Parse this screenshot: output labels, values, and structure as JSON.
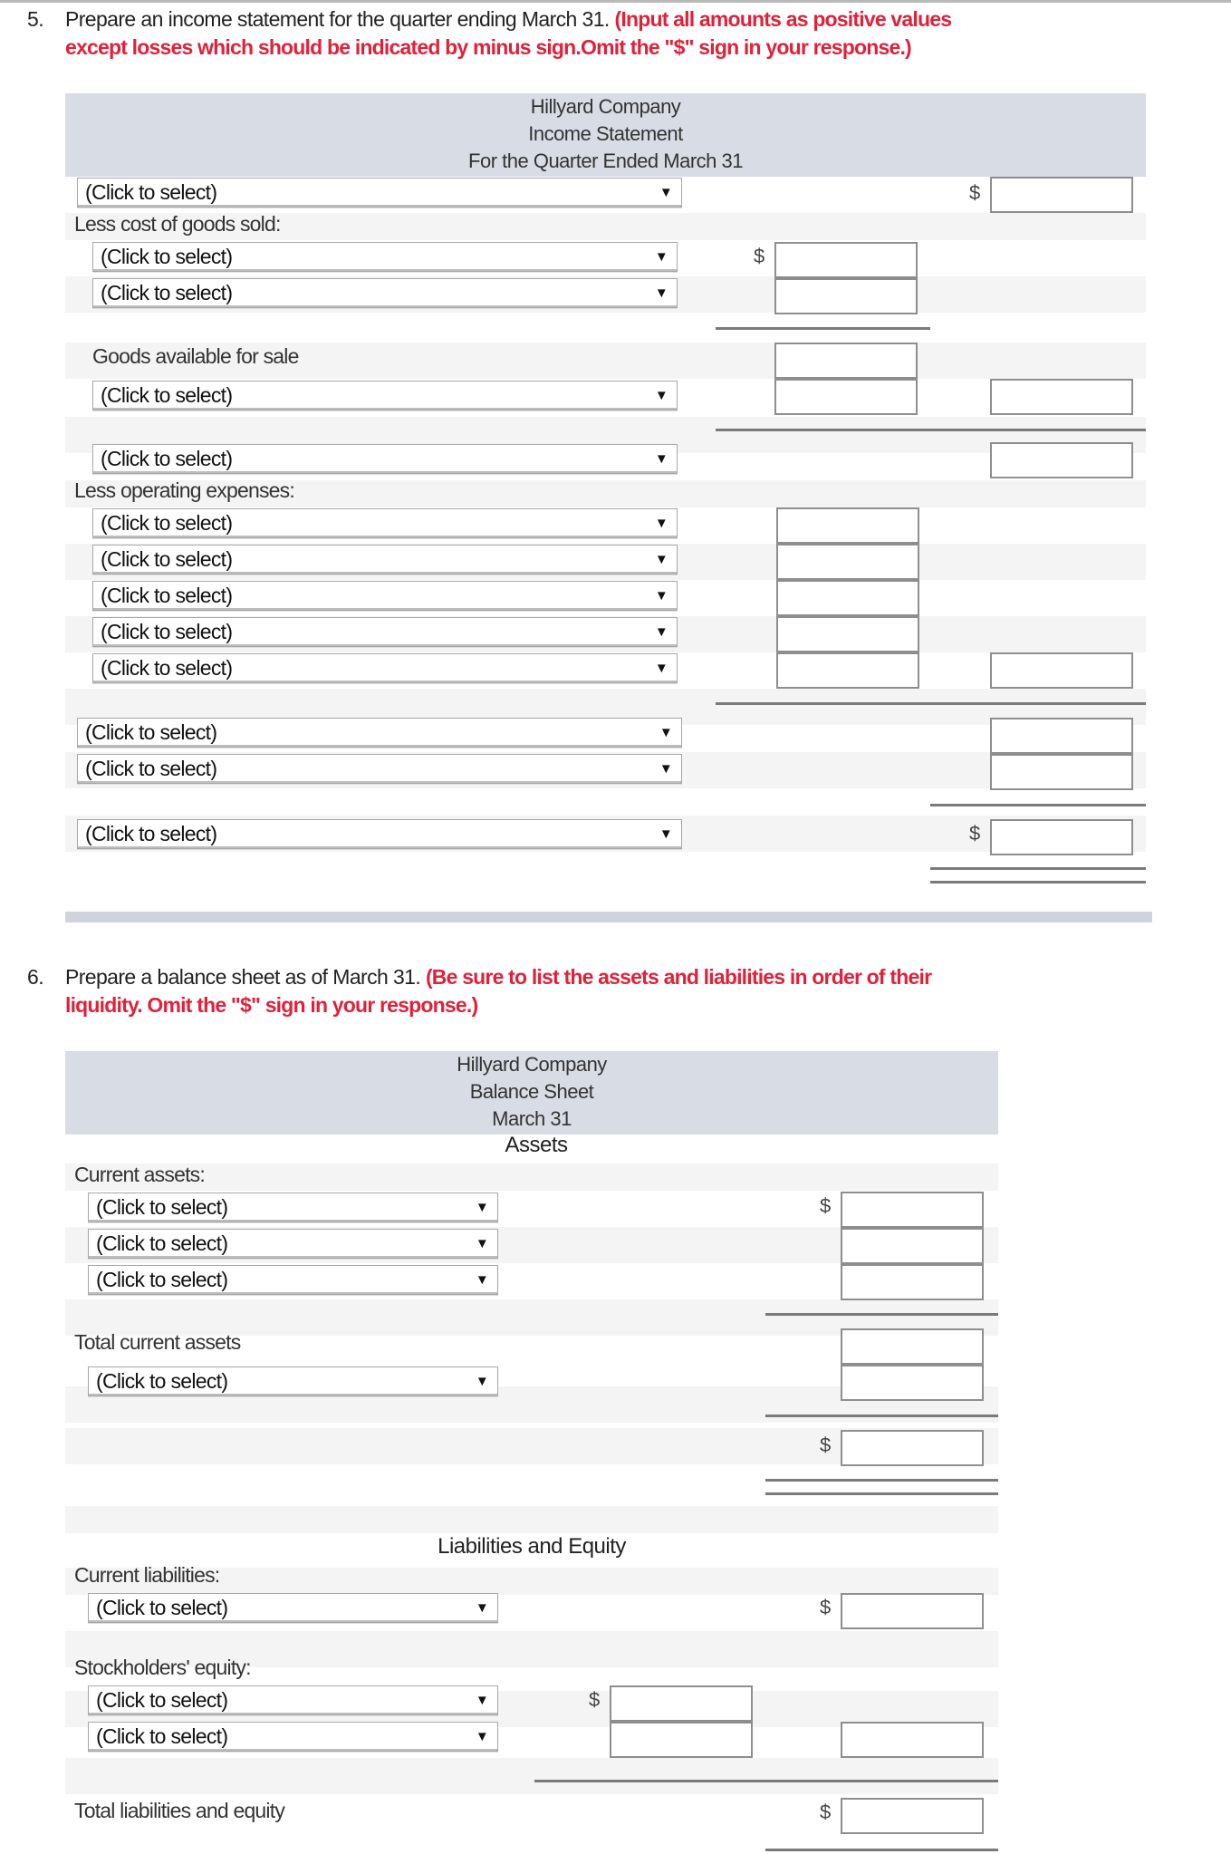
{
  "q5": {
    "number": "5.",
    "text": "Prepare an income statement for the quarter ending March 31.",
    "instruction_line1": "(Input all amounts as positive values",
    "instruction_line2": "except losses which should be indicated by minus sign.Omit the \"$\" sign in your response.)",
    "header": {
      "company": "Hillyard Company",
      "statement": "Income Statement",
      "period": "For the Quarter Ended March 31"
    },
    "labels": {
      "less_cogs": "Less cost of goods sold:",
      "goods_available": "Goods available for sale",
      "less_opex": "Less operating expenses:"
    },
    "select_placeholder": "(Click to select)",
    "dollar": "$"
  },
  "q6": {
    "number": "6.",
    "text": "Prepare a balance sheet as of March 31.",
    "instruction_line1": "(Be sure to list the assets and liabilities in order of their",
    "instruction_line2": "liquidity. Omit the \"$\" sign in your response.)",
    "header": {
      "company": "Hillyard Company",
      "statement": "Balance Sheet",
      "period": "March 31"
    },
    "sections": {
      "assets": "Assets",
      "liabilities_equity": "Liabilities and Equity"
    },
    "labels": {
      "current_assets": "Current assets:",
      "total_current_assets": "Total current assets",
      "current_liabilities": "Current liabilities:",
      "stockholders_equity": "Stockholders' equity:",
      "total_liabilities_equity": "Total liabilities and equity"
    },
    "select_placeholder": "(Click to select)",
    "dollar": "$"
  },
  "icons": {
    "dropdown_arrow": "▼"
  }
}
